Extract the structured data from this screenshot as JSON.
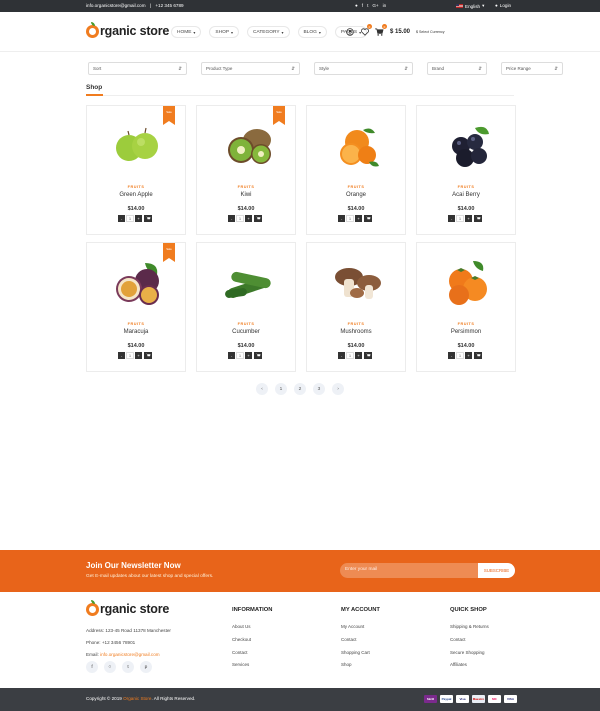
{
  "topbar": {
    "email": "info.organicstore@gmail.com",
    "separator": "|",
    "phone": "+12 345 6789",
    "language": "English",
    "login": "Login"
  },
  "header": {
    "logo_text": "rganic store",
    "nav": [
      "HOME",
      "SHOP",
      "CATEGORY",
      "BLOG",
      "PAGES"
    ],
    "wishlist_count": "0",
    "cart_count": "0",
    "cart_price": "$ 15.00",
    "currency_label": "$ Select Currency"
  },
  "filters": [
    "Sort",
    "Product Type",
    "Style",
    "Brand",
    "Price Range"
  ],
  "shop_title": "Shop",
  "products": [
    {
      "category": "FRUITS",
      "name": "Green Apple",
      "price": "$14.00",
      "qty": "1",
      "ribbon": "Sale",
      "image": "green-apple"
    },
    {
      "category": "FRUITS",
      "name": "Kiwi",
      "price": "$14.00",
      "qty": "1",
      "ribbon": "Sale",
      "image": "kiwi"
    },
    {
      "category": "FRUITS",
      "name": "Orange",
      "price": "$14.00",
      "qty": "1",
      "ribbon": "",
      "image": "orange"
    },
    {
      "category": "FRUITS",
      "name": "Acai Berry",
      "price": "$14.00",
      "qty": "1",
      "ribbon": "",
      "image": "acai-berry"
    },
    {
      "category": "FRUITS",
      "name": "Maracuja",
      "price": "$14.00",
      "qty": "1",
      "ribbon": "Sale",
      "image": "maracuja"
    },
    {
      "category": "FRUITS",
      "name": "Cucumber",
      "price": "$14.00",
      "qty": "1",
      "ribbon": "",
      "image": "cucumber"
    },
    {
      "category": "FRUITS",
      "name": "Mushrooms",
      "price": "$14.00",
      "qty": "1",
      "ribbon": "",
      "image": "mushrooms"
    },
    {
      "category": "FRUITS",
      "name": "Persimmon",
      "price": "$14.00",
      "qty": "1",
      "ribbon": "",
      "image": "persimmon"
    }
  ],
  "pagination": [
    "‹",
    "1",
    "2",
    "3",
    "›"
  ],
  "newsletter": {
    "title": "Join Our Newsletter Now",
    "subtitle": "Get E-mail updates about our latest shop and special offers.",
    "placeholder": "Enter your mail",
    "button": "SUBSCRIBE"
  },
  "footer": {
    "address": "Address: 123-45 Road 11378 Manchester",
    "phone": "Phone: +12 3456 78901",
    "email_label": "Email:",
    "email": "info.organicstore@gmail.com",
    "columns": [
      {
        "title": "INFORMATION",
        "links": [
          "About Us",
          "Checkout",
          "Contact",
          "Services"
        ]
      },
      {
        "title": "MY ACCOUNT",
        "links": [
          "My Account",
          "Contact",
          "Shopping Cart",
          "Shop"
        ]
      },
      {
        "title": "QUICK SHOP",
        "links": [
          "Shipping & Returns",
          "Contact",
          "Secure Shopping",
          "Affiliates"
        ]
      }
    ],
    "copyright_prefix": "Copyright © 2019",
    "copyright_brand": "Organic Store",
    "copyright_suffix": ". All Rights Reserved.",
    "payments": [
      "Skrill",
      "Paypal",
      "Visa",
      "Maestro",
      "MC",
      "VISA"
    ]
  },
  "colors": {
    "accent": "#f07c1f",
    "dark": "#2f3236",
    "newsletter": "#e8641a"
  }
}
